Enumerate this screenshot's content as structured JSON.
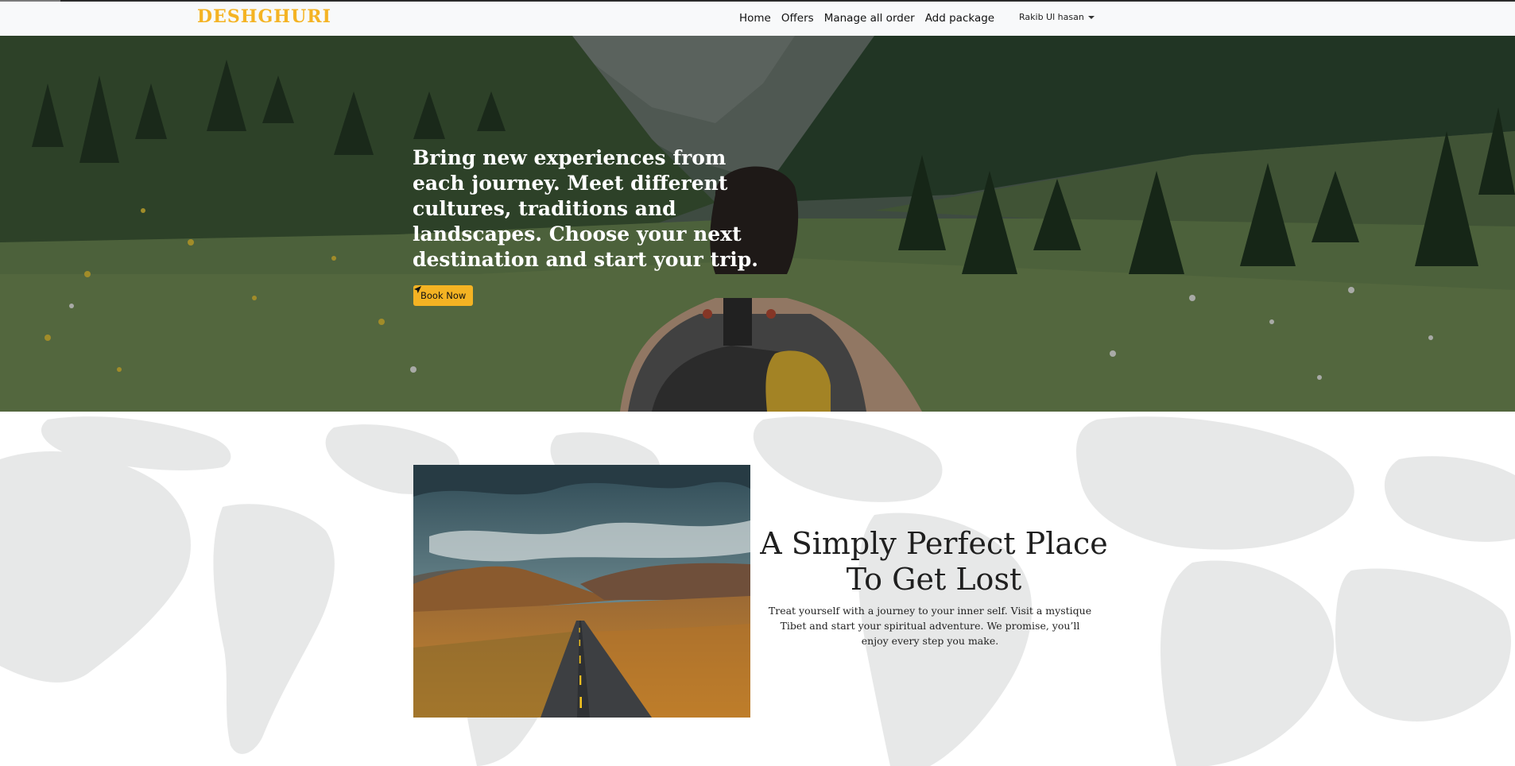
{
  "brand": {
    "name": "DESHGHURI",
    "color": "#f4b323"
  },
  "nav": {
    "links": [
      "Home",
      "Offers",
      "Manage all order",
      "Add package"
    ],
    "user": "Rakib Ul hasan"
  },
  "hero": {
    "headline": "Bring new experiences from each journey. Meet different cultures, traditions and landscapes. Choose your next destination and start your trip.",
    "button_label": "Book Now",
    "button_icon": "paper-plane-icon"
  },
  "about": {
    "title": "A Simply Perfect Place To Get Lost",
    "text": "Treat yourself with a journey to your inner self. Visit a mystique Tibet and start your spiritual adventure. We promise, you’ll enjoy every step you make."
  },
  "colors": {
    "accent": "#f4b323",
    "navbar_bg": "#f8f9fa",
    "map_gray": "#e7e8e8"
  }
}
